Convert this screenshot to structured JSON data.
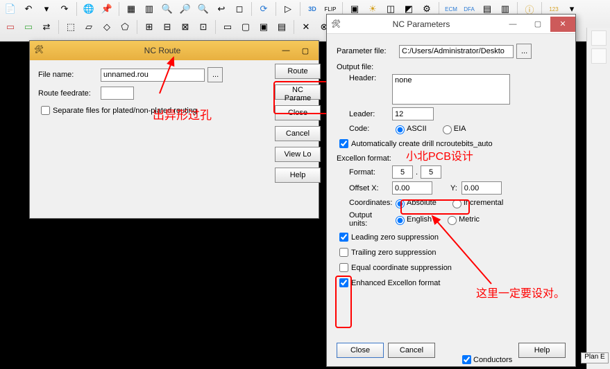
{
  "route_dialog": {
    "title": "NC Route",
    "file_name_label": "File name:",
    "file_name_value": "unnamed.rou",
    "feedrate_label": "Route feedrate:",
    "feedrate_value": "",
    "separate_label": "Separate files for plated/non-plated routing",
    "browse_label": "...",
    "buttons": {
      "route": "Route",
      "nc_param": "NC Parame",
      "close": "Close",
      "cancel": "Cancel",
      "view_log": "View Lo",
      "help": "Help"
    }
  },
  "param_dialog": {
    "title": "NC Parameters",
    "param_file_label": "Parameter file:",
    "param_file_value": "C:/Users/Administrator/Deskto",
    "browse_label": "...",
    "output_file_section": "Output file:",
    "header_label": "Header:",
    "header_value": "none",
    "leader_label": "Leader:",
    "leader_value": "12",
    "code_label": "Code:",
    "code_ascii": "ASCII",
    "code_eia": "EIA",
    "auto_create_label": "Automatically create drill ncroutebits_auto",
    "excellon_section": "Excellon format:",
    "format_label": "Format:",
    "format_a": "5",
    "format_dot": ".",
    "format_b": "5",
    "offset_x_label": "Offset X:",
    "offset_x_value": "0.00",
    "offset_y_label": "Y:",
    "offset_y_value": "0.00",
    "coords_label": "Coordinates:",
    "coords_abs": "Absolute",
    "coords_inc": "Incremental",
    "units_label": "Output units:",
    "units_en": "English",
    "units_me": "Metric",
    "leading_zero": "Leading zero suppression",
    "trailing_zero": "Trailing zero suppression",
    "equal_coord": "Equal coordinate suppression",
    "enhanced": "Enhanced Excellon format",
    "buttons": {
      "close": "Close",
      "cancel": "Cancel",
      "help": "Help"
    }
  },
  "annotations": {
    "top": "出异形过孔",
    "watermark": "小北PCB设计",
    "bottom": "这里一定要设对。"
  },
  "bottom_checks": {
    "conductors": "Conductors",
    "plan": "Plan E"
  }
}
